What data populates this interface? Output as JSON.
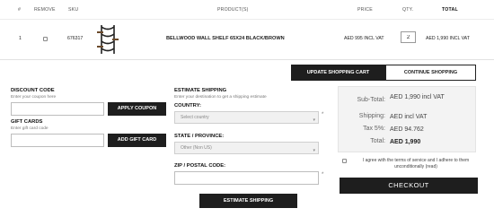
{
  "table": {
    "headers": {
      "num": "#",
      "remove": "REMOVE",
      "sku": "SKU",
      "product": "PRODUCT(S)",
      "price": "PRICE",
      "qty": "QTY.",
      "total": "TOTAL"
    },
    "row": {
      "num": "1",
      "sku": "676317",
      "product": "BELLWOOD WALL SHELF 65X24 BLACK/BROWN",
      "price": "AED 995 INCL VAT",
      "qty": "2",
      "total": "AED 1,990 INCL VAT",
      "remove_checked": false
    }
  },
  "cart_actions": {
    "update_label": "UPDATE SHOPPING CART",
    "continue_label": "CONTINUE SHOPPING"
  },
  "discount": {
    "title": "DISCOUNT CODE",
    "hint": "Enter your coupon here",
    "value": "",
    "button": "APPLY COUPON"
  },
  "gift": {
    "title": "GIFT CARDS",
    "hint": "Enter gift card code",
    "value": "",
    "button": "ADD GIFT CARD"
  },
  "shipping": {
    "title": "ESTIMATE SHIPPING",
    "hint": "Enter your destination to get a shipping estimate",
    "country_label": "COUNTRY:",
    "country_value": "Select country",
    "state_label": "STATE / PROVINCE:",
    "state_value": "Other (Non US)",
    "zip_label": "ZIP / POSTAL CODE:",
    "zip_value": "",
    "button": "ESTIMATE SHIPPING",
    "required_mark": "*"
  },
  "totals": {
    "subtotal_label": "Sub-Total:",
    "subtotal_value": "AED 1,990 incl VAT",
    "shipping_label": "Shipping:",
    "shipping_value": "AED incl VAT",
    "tax_label": "Tax 5%:",
    "tax_value": "AED 94.762",
    "total_label": "Total:",
    "total_value": "AED 1,990"
  },
  "terms": {
    "text": "I agree with the terms of service and I adhere to them unconditionally",
    "link": "(read)",
    "checked": false
  },
  "checkout": {
    "label": "CHECKOUT"
  },
  "colors": {
    "dark_button": "#1e1e1e",
    "panel": "#f3f3f3"
  },
  "icons": {
    "select_arrow": "chevron-down-icon",
    "product_image": "wall-shelf-product-icon"
  }
}
